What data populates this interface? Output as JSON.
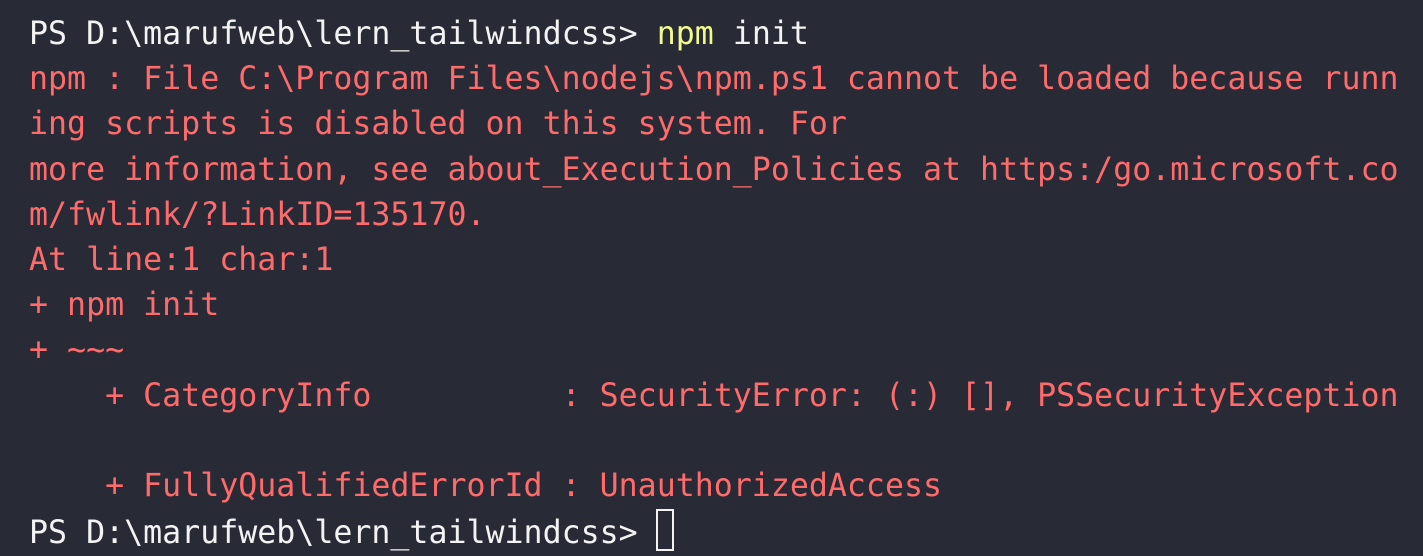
{
  "terminal": {
    "prompt1": "PS D:\\marufweb\\lern_tailwindcss>",
    "command_name": "npm",
    "command_args": "init",
    "error_lines": [
      "npm : File C:\\Program Files\\nodejs\\npm.ps1 cannot be loaded because runn",
      "ing scripts is disabled on this system. For",
      "more information, see about_Execution_Policies at https:/go.microsoft.co",
      "m/fwlink/?LinkID=135170.",
      "At line:1 char:1",
      "+ npm init",
      "+ ~~~",
      "    + CategoryInfo          : SecurityError: (:) [], PSSecurityException",
      "",
      "    + FullyQualifiedErrorId : UnauthorizedAccess"
    ],
    "prompt2": "PS D:\\marufweb\\lern_tailwindcss>",
    "colors": {
      "background": "#282a36",
      "text": "#f3f3f3",
      "error": "#ff6b6b",
      "command": "#f1fa8c"
    }
  }
}
